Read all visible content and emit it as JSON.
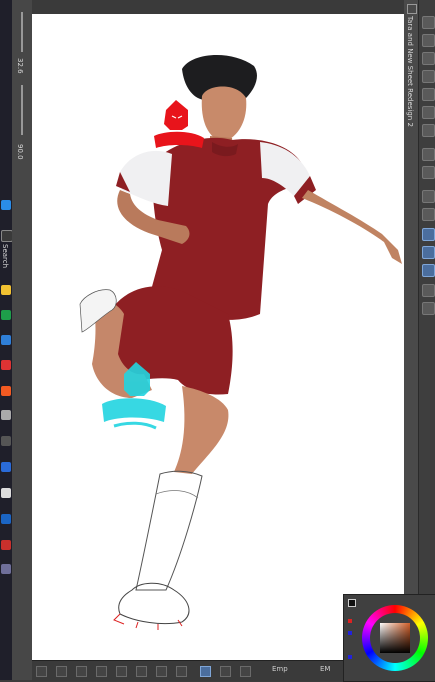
{
  "left_panel": {
    "zoom_value": "32.6",
    "angle_value": "90.0"
  },
  "taskbar": {
    "search_label": "Search"
  },
  "right_panel": {
    "document_tab": "Tara and New Sheet Redesign 2"
  },
  "bottom_bar": {
    "label_1": "Emp",
    "label_2": "EM"
  },
  "colors": {
    "jersey_red": "#8e1f23",
    "watermark_red": "#e8141b",
    "watermark_cyan": "#22d4e0"
  }
}
